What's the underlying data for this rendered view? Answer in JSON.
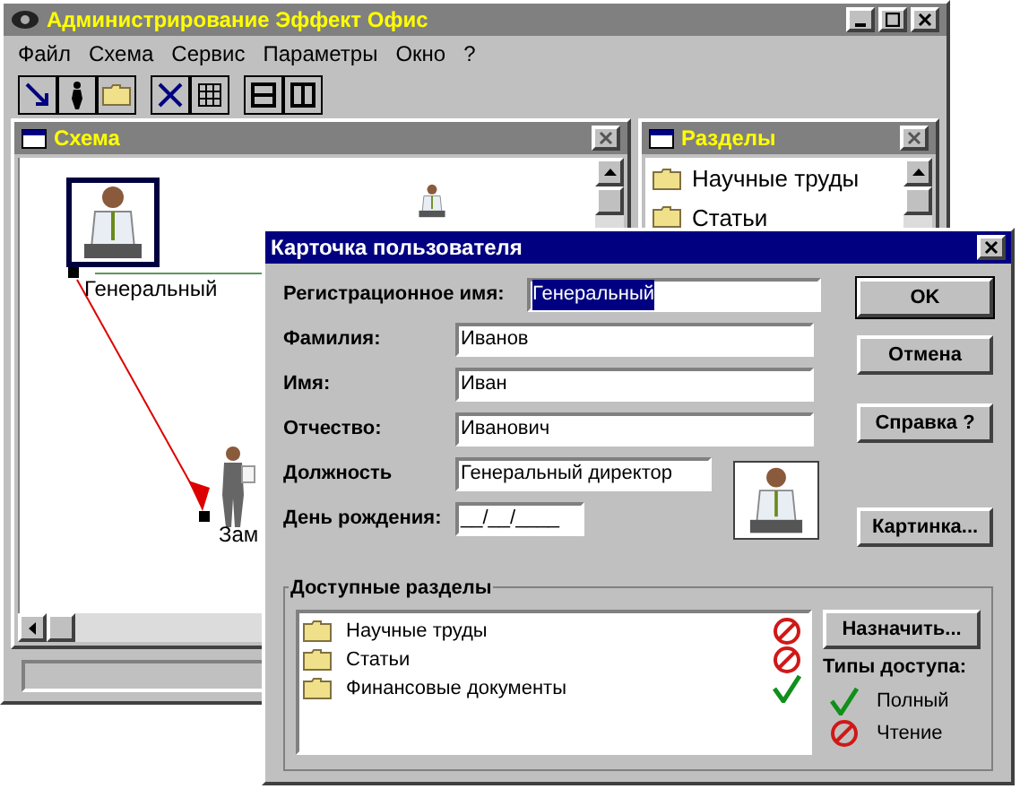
{
  "window": {
    "title": "Администрирование Эффект Офис"
  },
  "menu": [
    "Файл",
    "Схема",
    "Сервис",
    "Параметры",
    "Окно",
    "?"
  ],
  "schema": {
    "title": "Схема",
    "nodes": [
      {
        "label": "Генеральный",
        "selected": true
      },
      {
        "label": "Зам",
        "selected": false
      }
    ]
  },
  "sections_panel": {
    "title": "Разделы",
    "items": [
      "Научные труды",
      "Статьи"
    ]
  },
  "dialog": {
    "title": "Карточка пользователя",
    "fields": [
      {
        "label": "Регистрационное имя:",
        "value": "Генеральный",
        "selected": true
      },
      {
        "label": "Фамилия:",
        "value": "Иванов",
        "selected": false
      },
      {
        "label": "Имя:",
        "value": "Иван",
        "selected": false
      },
      {
        "label": "Отчество:",
        "value": "Иванович",
        "selected": false
      },
      {
        "label": "Должность",
        "value": "Генеральный директор",
        "selected": false
      },
      {
        "label": "День рождения:",
        "value": "__/__/____",
        "selected": false
      }
    ],
    "buttons": [
      "OK",
      "Отмена",
      "Справка ?"
    ],
    "picture_button": "Картинка...",
    "sections": {
      "title": "Доступные разделы",
      "items": [
        {
          "name": "Научные труды",
          "kind": "read"
        },
        {
          "name": "Статьи",
          "kind": "read"
        },
        {
          "name": "Финансовые документы",
          "kind": "full"
        }
      ]
    },
    "assign_button": "Назначить...",
    "legend": {
      "title": "Типы доступа:",
      "items": [
        {
          "kind": "full",
          "label": "Полный"
        },
        {
          "kind": "read",
          "label": "Чтение"
        }
      ]
    }
  }
}
